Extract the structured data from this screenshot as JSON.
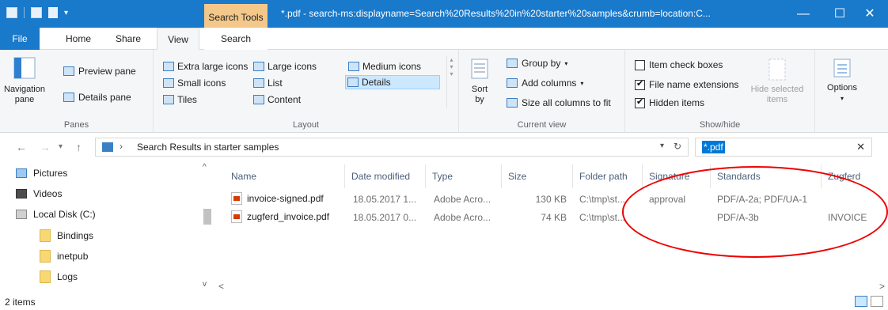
{
  "titlebar": {
    "contextual_tab": "Search Tools",
    "title": "*.pdf - search-ms:displayname=Search%20Results%20in%20starter%20samples&crumb=location:C..."
  },
  "tabs": [
    "File",
    "Home",
    "Share",
    "View",
    "Search"
  ],
  "ribbon": {
    "panes": {
      "label": "Panes",
      "navigation_pane": "Navigation pane",
      "preview_pane": "Preview pane",
      "details_pane": "Details pane"
    },
    "layout": {
      "label": "Layout",
      "items": [
        "Extra large icons",
        "Large icons",
        "Medium icons",
        "Small icons",
        "List",
        "Details",
        "Tiles",
        "Content"
      ],
      "selected": "Details"
    },
    "current_view": {
      "label": "Current view",
      "sort_by": "Sort by",
      "group_by": "Group by",
      "add_columns": "Add columns",
      "size_all": "Size all columns to fit"
    },
    "show_hide": {
      "label": "Show/hide",
      "item_check_boxes": "Item check boxes",
      "file_name_extensions": "File name extensions",
      "hidden_items": "Hidden items",
      "hide_selected": "Hide selected items",
      "checks": {
        "item_check_boxes": false,
        "file_name_extensions": true,
        "hidden_items": true
      }
    },
    "options": "Options"
  },
  "address": {
    "path": "Search Results in starter samples",
    "search_query": "*.pdf"
  },
  "navpane": {
    "items": [
      "Pictures",
      "Videos",
      "Local Disk (C:)",
      "Bindings",
      "inetpub",
      "Logs"
    ]
  },
  "columns": [
    "Name",
    "Date modified",
    "Type",
    "Size",
    "Folder path",
    "Signature",
    "Standards",
    "Zugferd"
  ],
  "files": [
    {
      "name": "invoice-signed.pdf",
      "date": "18.05.2017 1...",
      "type": "Adobe Acro...",
      "size": "130 KB",
      "folder": "C:\\tmp\\st...",
      "signature": "approval",
      "standards": "PDF/A-2a; PDF/UA-1",
      "zugferd": ""
    },
    {
      "name": "zugferd_invoice.pdf",
      "date": "18.05.2017 0...",
      "type": "Adobe Acro...",
      "size": "74 KB",
      "folder": "C:\\tmp\\st...",
      "signature": "",
      "standards": "PDF/A-3b",
      "zugferd": "INVOICE"
    }
  ],
  "status": {
    "count": "2 items"
  },
  "colors": {
    "titlebar": "#1979ca",
    "search_tools_tab": "#f3c88a",
    "highlight_oval": "#e00000"
  }
}
